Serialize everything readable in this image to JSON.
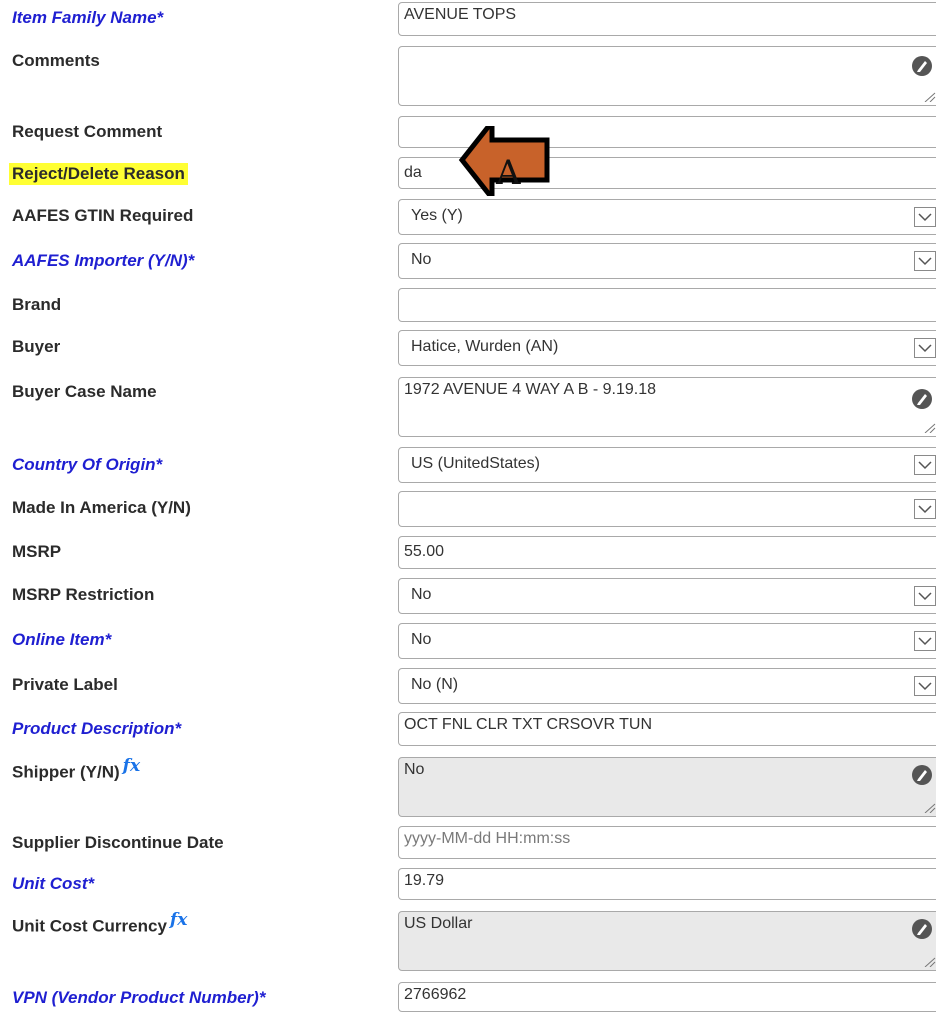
{
  "fields": {
    "item_family_name": {
      "label": "Item Family Name*",
      "value": "AVENUE TOPS"
    },
    "comments": {
      "label": "Comments",
      "value": ""
    },
    "request_comment": {
      "label": "Request Comment",
      "value": ""
    },
    "reject_reason": {
      "label": "Reject/Delete Reason",
      "value": "da"
    },
    "gtin_required": {
      "label": "AAFES GTIN Required",
      "value": "Yes (Y)"
    },
    "importer": {
      "label": "AAFES Importer (Y/N)*",
      "value": "No"
    },
    "brand": {
      "label": "Brand",
      "value": ""
    },
    "buyer": {
      "label": "Buyer",
      "value": "Hatice, Wurden (AN)"
    },
    "buyer_case_name": {
      "label": "Buyer Case Name",
      "value": "1972 AVENUE 4 WAY A B - 9.19.18"
    },
    "country_of_origin": {
      "label": "Country Of Origin*",
      "value": "US (UnitedStates)"
    },
    "made_in_america": {
      "label": "Made In America (Y/N)",
      "value": ""
    },
    "msrp": {
      "label": "MSRP",
      "value": "55.00"
    },
    "msrp_restriction": {
      "label": "MSRP Restriction",
      "value": "No"
    },
    "online_item": {
      "label": "Online Item*",
      "value": "No"
    },
    "private_label": {
      "label": "Private Label",
      "value": "No (N)"
    },
    "product_description": {
      "label": "Product Description*",
      "value": "OCT FNL CLR TXT CRSOVR TUN"
    },
    "shipper": {
      "label": "Shipper (Y/N)",
      "value": "No"
    },
    "supplier_discontinue_date": {
      "label": "Supplier Discontinue Date",
      "placeholder": "yyyy-MM-dd HH:mm:ss"
    },
    "unit_cost": {
      "label": "Unit Cost*",
      "value": "19.79"
    },
    "unit_cost_currency": {
      "label": "Unit Cost Currency",
      "value": "US Dollar"
    },
    "vpn": {
      "label": "VPN (Vendor Product Number)*",
      "value": "2766962"
    }
  },
  "annotation": {
    "label": "A",
    "color": "#c8622a"
  },
  "formula_icon": "fx",
  "colors": {
    "required_label": "#1f1fd1",
    "highlight": "#ffff33",
    "readonly_bg": "#e9e9e9"
  }
}
